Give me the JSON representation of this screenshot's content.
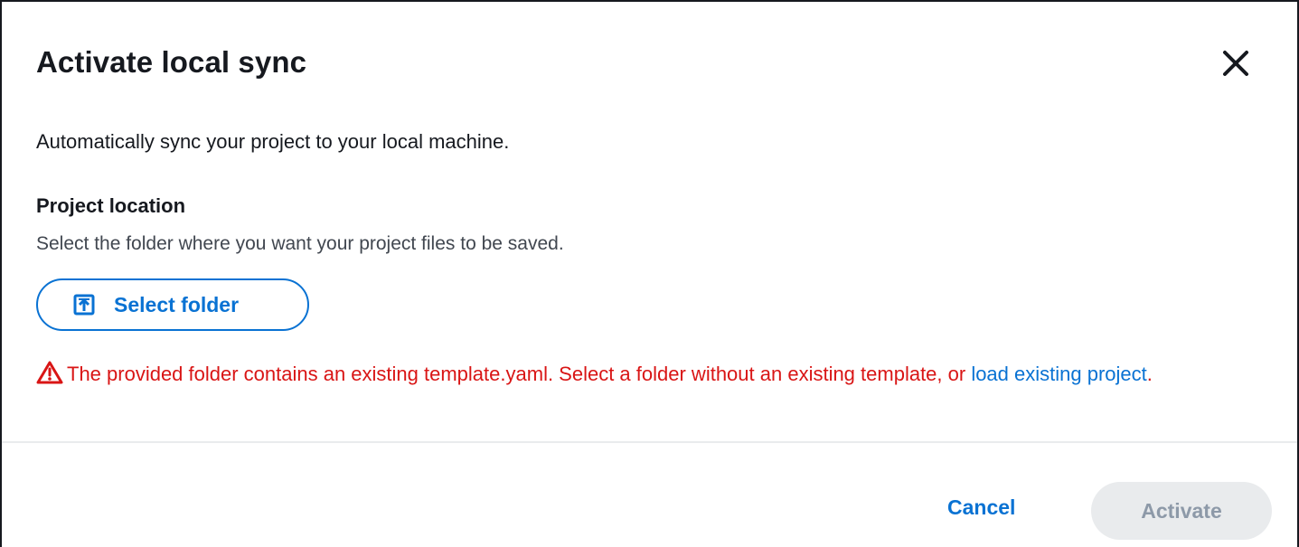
{
  "dialog": {
    "title": "Activate local sync",
    "close_icon": "close-icon",
    "description": "Automatically sync your project to your local machine."
  },
  "project_location": {
    "label": "Project location",
    "hint": "Select the folder where you want your project files to be saved.",
    "select_button_label": "Select folder",
    "select_button_icon": "folder-upload-icon"
  },
  "error": {
    "icon": "warning-icon",
    "message": "The provided folder contains an existing template.yaml. Select a folder without an existing template, or ",
    "link_label": "load existing project",
    "suffix": "."
  },
  "footer": {
    "cancel_label": "Cancel",
    "activate_label": "Activate",
    "activate_disabled": true
  },
  "colors": {
    "accent": "#0972d3",
    "error": "#d91515",
    "disabled_bg": "#e9ebed",
    "disabled_text": "#8d99a8",
    "text": "#16191f"
  }
}
